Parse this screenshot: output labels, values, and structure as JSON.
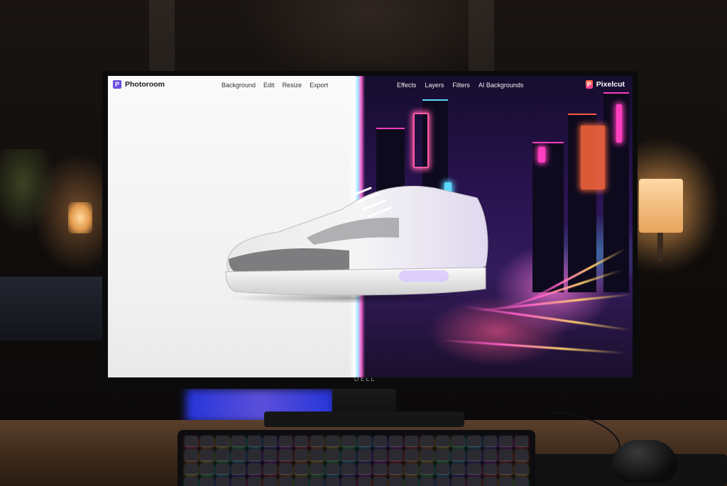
{
  "screen": {
    "left_app": {
      "brand": "Photoroom",
      "menu": [
        "Background",
        "Edit",
        "Resize",
        "Export"
      ]
    },
    "right_app": {
      "brand": "Pixelcut",
      "menu": [
        "Effects",
        "Layers",
        "Filters",
        "AI Backgrounds"
      ]
    }
  },
  "monitor": {
    "logo": "DELL"
  },
  "icons": {
    "photoroom": "photoroom-logo-icon",
    "pixelcut": "pixelcut-logo-icon"
  },
  "colors": {
    "photoroom_accent": "#6b4fe0",
    "pixelcut_accent": "#ff3d9a",
    "neon_pink": "#ff3fbf",
    "neon_cyan": "#5ad8ff"
  }
}
